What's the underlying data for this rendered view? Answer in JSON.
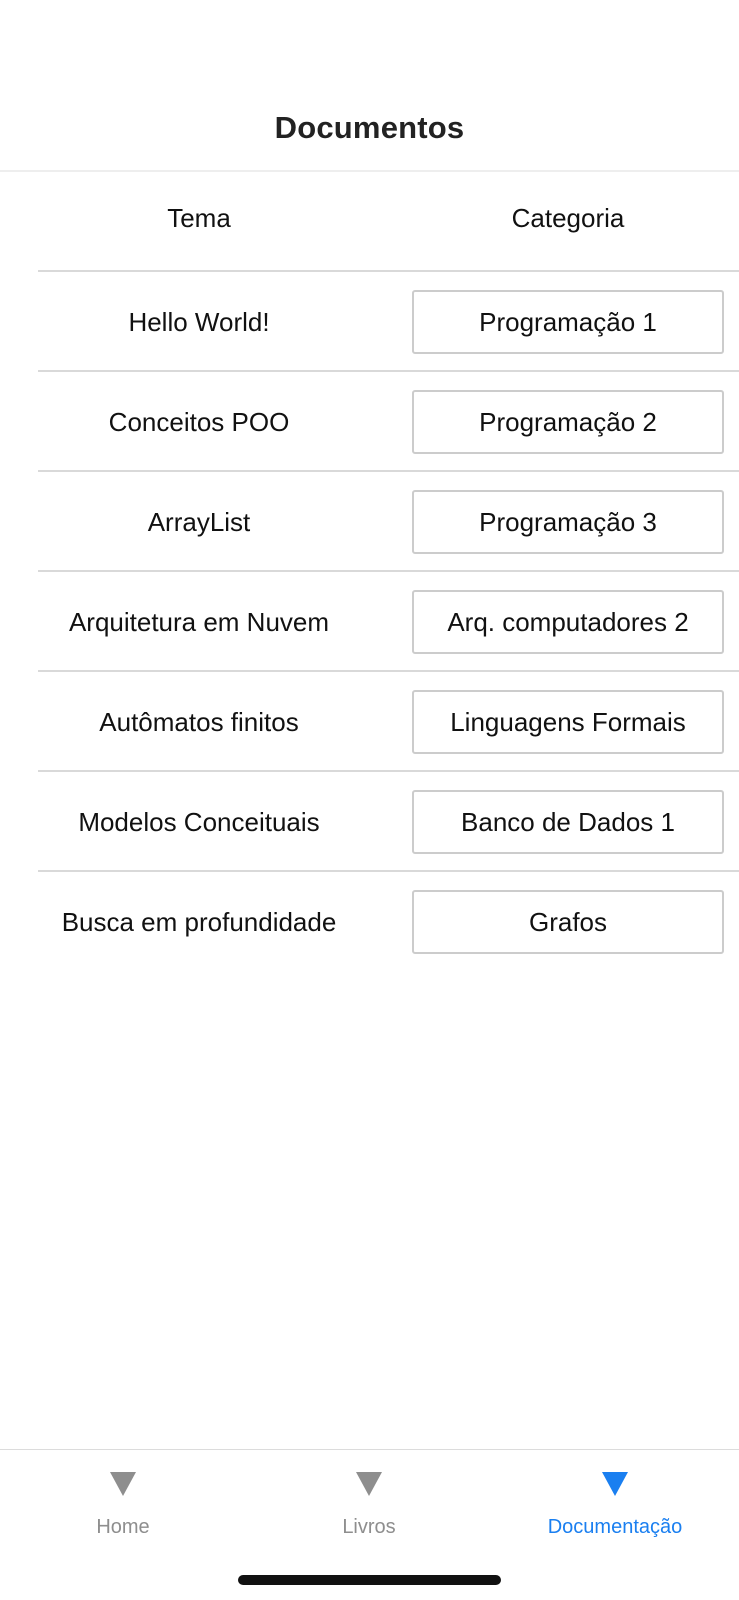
{
  "header": {
    "title": "Documentos"
  },
  "table": {
    "col_tema": "Tema",
    "col_categoria": "Categoria",
    "rows": [
      {
        "tema": "Hello World!",
        "categoria": "Programação 1"
      },
      {
        "tema": "Conceitos POO",
        "categoria": "Programação 2"
      },
      {
        "tema": "ArrayList",
        "categoria": "Programação 3"
      },
      {
        "tema": "Arquitetura em Nuvem",
        "categoria": "Arq. computadores 2"
      },
      {
        "tema": "Autômatos finitos",
        "categoria": "Linguagens Formais"
      },
      {
        "tema": "Modelos Conceituais",
        "categoria": "Banco de Dados 1"
      },
      {
        "tema": "Busca em profundidade",
        "categoria": "Grafos"
      }
    ]
  },
  "tabbar": {
    "tabs": [
      {
        "label": "Home",
        "icon": "triangle-down-icon",
        "active": false
      },
      {
        "label": "Livros",
        "icon": "triangle-down-icon",
        "active": false
      },
      {
        "label": "Documentação",
        "icon": "triangle-down-icon",
        "active": true
      }
    ]
  },
  "colors": {
    "accent": "#1a7ff0",
    "inactive": "#8e8e8e",
    "divider": "#d9d9d9"
  }
}
